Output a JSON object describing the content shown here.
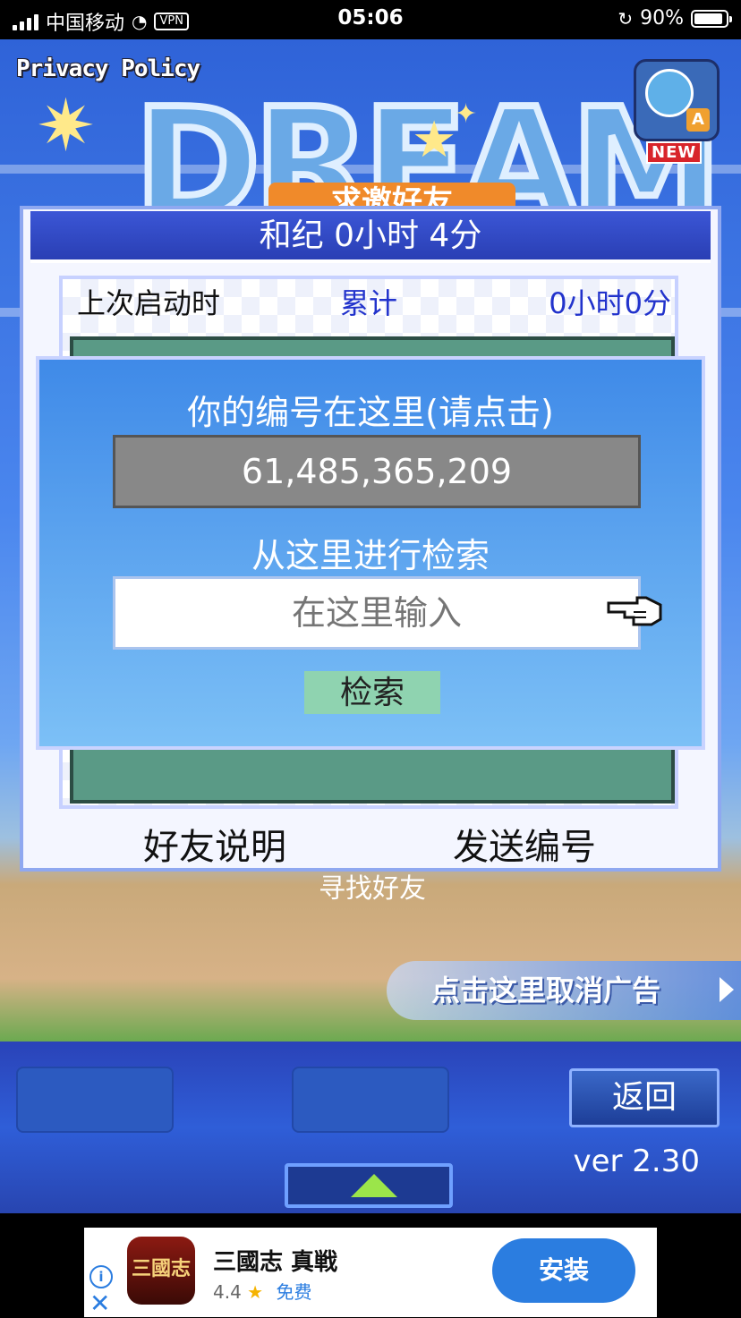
{
  "status_bar": {
    "carrier": "中国移动",
    "vpn": "VPN",
    "time": "05:06",
    "battery": "90%",
    "battery_level": 0.9
  },
  "header": {
    "privacy_policy": "Privacy Policy",
    "logo_text": "DREAM",
    "invite_banner": "求邀好友",
    "new_badge": "NEW",
    "lang_badge": "A"
  },
  "friend_panel": {
    "title": "和纪  0小时 4分",
    "last_launch_label": "上次启动时",
    "total_label": "累计",
    "total_value": "0小时0分",
    "find_friend": "寻找好友",
    "friend_help": "好友说明",
    "send_id": "发送编号"
  },
  "search_dialog": {
    "title": "你的编号在这里(请点击)",
    "player_id": "61,485,365,209",
    "search_title": "从这里进行检索",
    "input_placeholder": "在这里输入",
    "search_button": "检索"
  },
  "bottom": {
    "ad_cancel": "点击这里取消广告",
    "back_button": "返回",
    "version": "ver 2.30"
  },
  "ad_banner": {
    "info": "i",
    "close": "✕",
    "app_icon_text": "三國志",
    "app_name": "三國志 真戦",
    "rating": "4.4",
    "price": "免费",
    "install": "安装"
  }
}
